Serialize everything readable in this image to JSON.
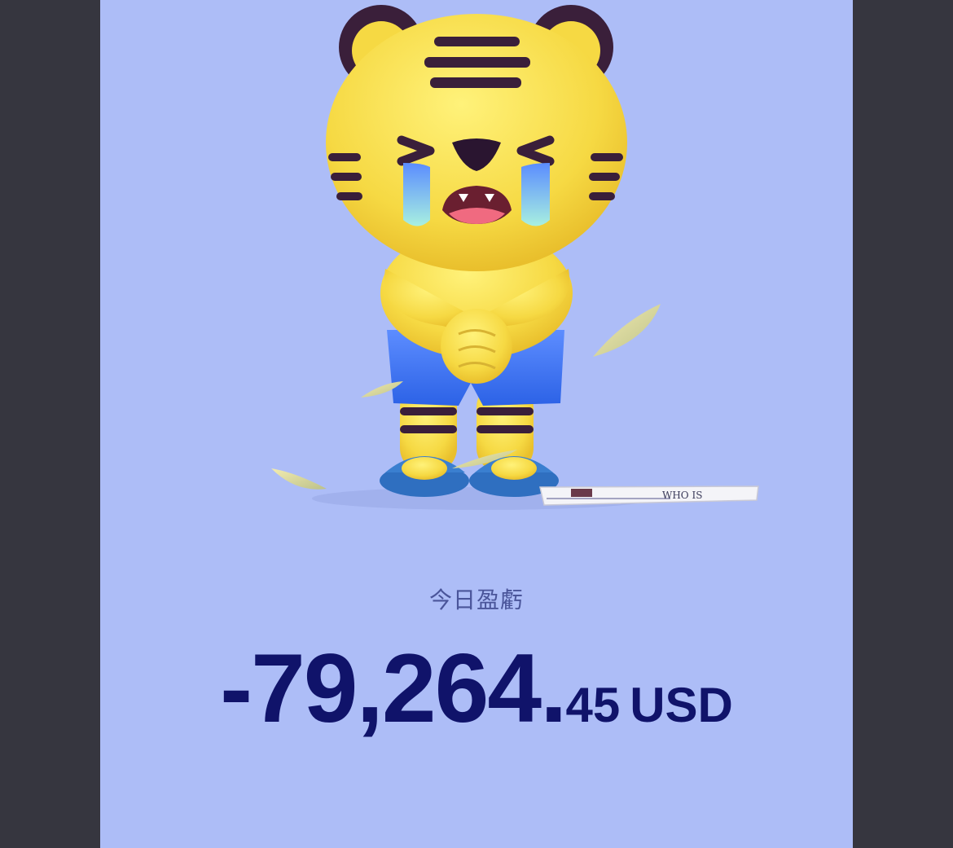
{
  "pnl": {
    "label": "今日盈虧",
    "integer_part": "-79,264.",
    "decimal_part": "45",
    "currency": "USD"
  },
  "illustration": {
    "subject": "crying tiger mascot",
    "newspaper_text": "WHO IS"
  },
  "colors": {
    "background_outer": "#36363f",
    "card": "#adbdf7",
    "label_text": "#4a559a",
    "amount_text": "#10136a"
  }
}
